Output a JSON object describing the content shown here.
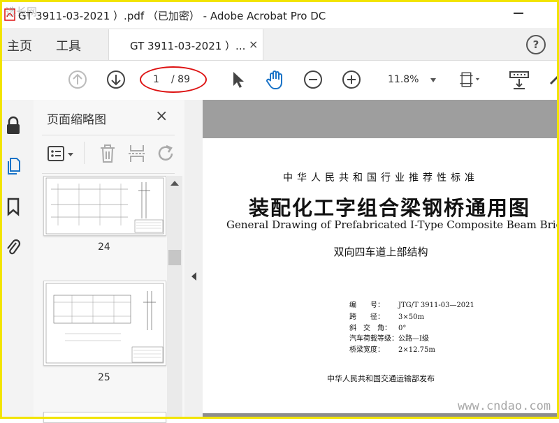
{
  "window": {
    "title": "GT 3911-03-2021 ）.pdf （已加密） - Adobe Acrobat Pro DC",
    "watermark_top": "选长网"
  },
  "nav": {
    "home": "主页",
    "tools": "工具"
  },
  "tab": {
    "label": "GT 3911-03-2021 ）...",
    "close": "×"
  },
  "help": {
    "label": "?"
  },
  "toolbar": {
    "page_current": "1",
    "page_total": "/ 89",
    "zoom": "11.8%"
  },
  "thumb_panel": {
    "title": "页面缩略图",
    "close": "×",
    "thumbnails": [
      {
        "label": "24"
      },
      {
        "label": "25"
      }
    ]
  },
  "document": {
    "line1": "中华人民共和国行业推荐性标准",
    "line2": "装配化工字组合梁钢桥通用图",
    "line3": "General Drawing of Prefabricated I-Type Composite Beam Brid",
    "line4": "双向四车道上部结构",
    "specs": [
      {
        "key": "编　　号：",
        "value": "JTG/T 3911-03—2021"
      },
      {
        "key": "跨　　径：",
        "value": "3×50m"
      },
      {
        "key": "斜　交　角：",
        "value": "0°"
      },
      {
        "key": "汽车荷载等级：",
        "value": "公路—Ⅰ级"
      },
      {
        "key": "桥梁宽度：",
        "value": "2×12.75m"
      }
    ],
    "publisher": "中华人民共和国交通运输部发布"
  },
  "watermark_bottom": "www.cndao.com",
  "colors": {
    "accent_blue": "#1a73c7",
    "annotation_red": "#d11111",
    "frame_yellow": "#f2e400"
  }
}
